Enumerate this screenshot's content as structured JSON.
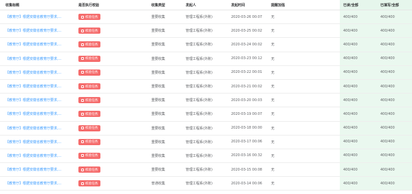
{
  "table": {
    "columns": [
      "收集标题",
      "是否执行校验",
      "收集类型",
      "发起人",
      "发起时间",
      "提醒加强",
      "已读/全部",
      "已填写/全部"
    ],
    "rows": [
      {
        "title": "【教育厅】根据安徽省教育厅要求,...",
        "check": "校验任务",
        "type": "重要收集",
        "sender": "管理工程系(外账)",
        "time": "2020-03-26 00:07",
        "remind": "无",
        "read": "400/400",
        "filled": "400/400"
      },
      {
        "title": "【教育厅】根据安徽省教育厅要求,...",
        "check": "校验任务",
        "type": "重要收集",
        "sender": "管理工程系(外账)",
        "time": "2020-03-25 00:02",
        "remind": "无",
        "read": "400/400",
        "filled": "400/400"
      },
      {
        "title": "【教育厅】根据安徽省教育厅要求,...",
        "check": "校验任务",
        "type": "重要收集",
        "sender": "管理工程系(外账)",
        "time": "2020-03-24 00:02",
        "remind": "无",
        "read": "400/400",
        "filled": "400/400"
      },
      {
        "title": "【教育厅】根据安徽省教育厅要求,...",
        "check": "校验任务",
        "type": "重要收集",
        "sender": "管理工程系(外账)",
        "time": "2020-03-23 00:12",
        "remind": "无",
        "read": "400/400",
        "filled": "400/400"
      },
      {
        "title": "【教育厅】根据安徽省教育厅要求,...",
        "check": "校验任务",
        "type": "重要收集",
        "sender": "管理工程系(外账)",
        "time": "2020-03-22 00:01",
        "remind": "无",
        "read": "400/400",
        "filled": "400/400"
      },
      {
        "title": "【教育厅】根据安徽省教育厅要求,...",
        "check": "校验任务",
        "type": "重要收集",
        "sender": "管理工程系(外账)",
        "time": "2020-03-21 00:02",
        "remind": "无",
        "read": "400/400",
        "filled": "400/400"
      },
      {
        "title": "【教育厅】根据安徽省教育厅要求,...",
        "check": "校验任务",
        "type": "重要收集",
        "sender": "管理工程系(外账)",
        "time": "2020-03-20 00:03",
        "remind": "无",
        "read": "400/400",
        "filled": "400/400"
      },
      {
        "title": "【教育厅】根据安徽省教育厅要求,...",
        "check": "校验任务",
        "type": "重要收集",
        "sender": "管理工程系(外账)",
        "time": "2020-03-19 00:07",
        "remind": "无",
        "read": "400/400",
        "filled": "400/400"
      },
      {
        "title": "【教育厅】根据安徽省教育厅要求,...",
        "check": "校验任务",
        "type": "重要收集",
        "sender": "管理工程系(外账)",
        "time": "2020-03-18 00:00",
        "remind": "无",
        "read": "400/400",
        "filled": "400/400"
      },
      {
        "title": "【教育厅】根据安徽省教育厅要求,...",
        "check": "校验任务",
        "type": "重要收集",
        "sender": "管理工程系(外账)",
        "time": "2020-03-17 00:06",
        "remind": "无",
        "read": "400/400",
        "filled": "400/400"
      },
      {
        "title": "【教育厅】根据安徽省教育厅要求,...",
        "check": "校验任务",
        "type": "重要收集",
        "sender": "管理工程系(外账)",
        "time": "2020-03-16 00:32",
        "remind": "无",
        "read": "400/400",
        "filled": "400/400"
      },
      {
        "title": "【教育厅】根据安徽省教育厅要求,...",
        "check": "校验任务",
        "type": "重要收集",
        "sender": "管理工程系(外账)",
        "time": "2020-03-15 00:08",
        "remind": "无",
        "read": "400/400",
        "filled": "400/400"
      },
      {
        "title": "【教育厅】根据安徽省教育厅要求,...",
        "check": "校验任务",
        "type": "普通收集",
        "sender": "管理工程系(外账)",
        "time": "2020-03-14 00:06",
        "remind": "无",
        "read": "400/400",
        "filled": "400/400"
      }
    ]
  },
  "colors": {
    "link": "#409eff",
    "tag": "#f56c6c",
    "stat_bg": "#eaf8ef"
  }
}
